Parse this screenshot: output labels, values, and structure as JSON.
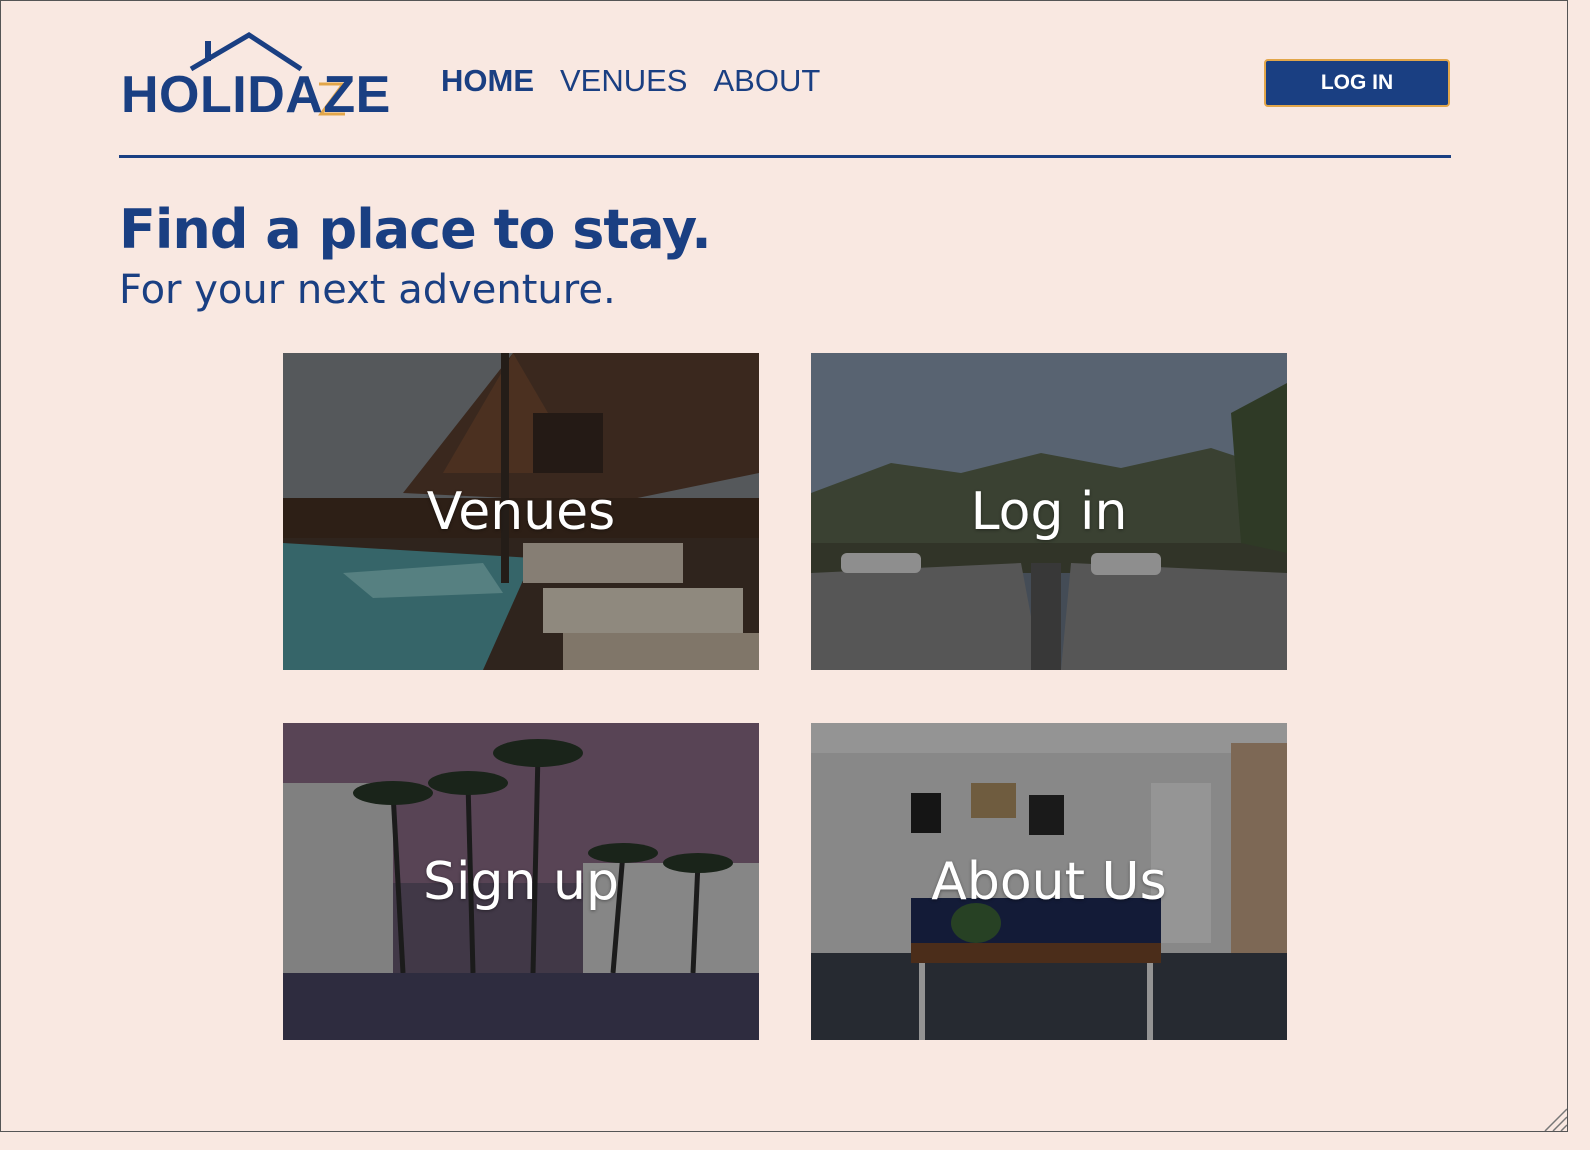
{
  "brand": {
    "logo_text_start": "HOLIDA",
    "logo_text_z": "Z",
    "logo_text_end": "E",
    "primary_color": "#1a3f82",
    "accent_color": "#e2a64a",
    "background_color": "#f9e8e1"
  },
  "nav": {
    "items": [
      {
        "label": "HOME",
        "active": true
      },
      {
        "label": "VENUES",
        "active": false
      },
      {
        "label": "ABOUT",
        "active": false
      }
    ],
    "login_label": "LOG IN"
  },
  "hero": {
    "title": "Find a place to stay.",
    "subtitle": "For your next adventure."
  },
  "cards": [
    {
      "label": "Venues"
    },
    {
      "label": "Log in"
    },
    {
      "label": "Sign up"
    },
    {
      "label": "About Us"
    }
  ]
}
